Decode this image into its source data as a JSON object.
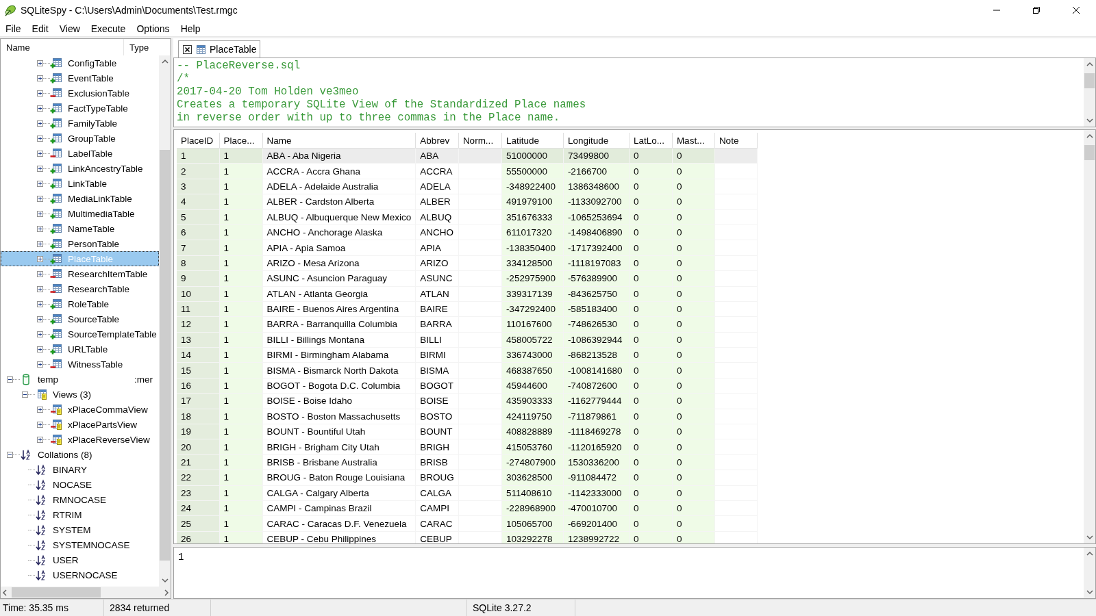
{
  "window": {
    "title": "SQLiteSpy - C:\\Users\\Admin\\Documents\\Test.rmgc"
  },
  "menu": [
    "File",
    "Edit",
    "View",
    "Execute",
    "Options",
    "Help"
  ],
  "tree": {
    "columns": [
      "Name",
      "Type"
    ],
    "items": [
      {
        "children": [
          {
            "children": [
              {
                "label": "ConfigTable",
                "kind": "table_plus",
                "expanded": false,
                "selected": false
              },
              {
                "label": "EventTable",
                "kind": "table_plus",
                "expanded": false,
                "selected": false
              },
              {
                "label": "ExclusionTable",
                "kind": "table_minus",
                "expanded": false,
                "selected": false
              },
              {
                "label": "FactTypeTable",
                "kind": "table_plus",
                "expanded": false,
                "selected": false
              },
              {
                "label": "FamilyTable",
                "kind": "table_plus",
                "expanded": false,
                "selected": false
              },
              {
                "label": "GroupTable",
                "kind": "table_plus",
                "expanded": false,
                "selected": false
              },
              {
                "label": "LabelTable",
                "kind": "table_minus",
                "expanded": false,
                "selected": false
              },
              {
                "label": "LinkAncestryTable",
                "kind": "table_plus",
                "expanded": false,
                "selected": false
              },
              {
                "label": "LinkTable",
                "kind": "table_plus",
                "expanded": false,
                "selected": false
              },
              {
                "label": "MediaLinkTable",
                "kind": "table_plus",
                "expanded": false,
                "selected": false
              },
              {
                "label": "MultimediaTable",
                "kind": "table_plus",
                "expanded": false,
                "selected": false
              },
              {
                "label": "NameTable",
                "kind": "table_plus",
                "expanded": false,
                "selected": false
              },
              {
                "label": "PersonTable",
                "kind": "table_plus",
                "expanded": false,
                "selected": false
              },
              {
                "label": "PlaceTable",
                "kind": "table_plus",
                "expanded": false,
                "selected": true
              },
              {
                "label": "ResearchItemTable",
                "kind": "table_minus",
                "expanded": false,
                "selected": false
              },
              {
                "label": "ResearchTable",
                "kind": "table_minus",
                "expanded": false,
                "selected": false
              },
              {
                "label": "RoleTable",
                "kind": "table_plus",
                "expanded": false,
                "selected": false
              },
              {
                "label": "SourceTable",
                "kind": "table_plus",
                "expanded": false,
                "selected": false
              },
              {
                "label": "SourceTemplateTable",
                "kind": "table_plus",
                "expanded": false,
                "selected": false
              },
              {
                "label": "URLTable",
                "kind": "table_plus",
                "expanded": false,
                "selected": false
              },
              {
                "label": "WitnessTable",
                "kind": "table_minus",
                "expanded": false,
                "selected": false
              }
            ]
          }
        ]
      },
      {
        "label": "temp",
        "type": ":mer",
        "kind": "database",
        "expanded": true,
        "selected": false,
        "children": [
          {
            "label": "Views (3)",
            "kind": "views",
            "expanded": true,
            "selected": false,
            "children": [
              {
                "label": "xPlaceCommaView",
                "kind": "view",
                "expanded": false,
                "selected": false
              },
              {
                "label": "xPlacePartsView",
                "kind": "view",
                "expanded": false,
                "selected": false
              },
              {
                "label": "xPlaceReverseView",
                "kind": "view",
                "expanded": false,
                "selected": false
              }
            ]
          }
        ]
      },
      {
        "label": "Collations (8)",
        "kind": "collations",
        "expanded": true,
        "selected": false,
        "children": [
          {
            "label": "BINARY",
            "kind": "collation",
            "selected": false
          },
          {
            "label": "NOCASE",
            "kind": "collation",
            "selected": false
          },
          {
            "label": "RMNOCASE",
            "kind": "collation",
            "selected": false
          },
          {
            "label": "RTRIM",
            "kind": "collation",
            "selected": false
          },
          {
            "label": "SYSTEM",
            "kind": "collation",
            "selected": false
          },
          {
            "label": "SYSTEMNOCASE",
            "kind": "collation",
            "selected": false
          },
          {
            "label": "USER",
            "kind": "collation",
            "selected": false
          },
          {
            "label": "USERNOCASE",
            "kind": "collation",
            "selected": false
          }
        ]
      }
    ]
  },
  "tabs": [
    {
      "label": "PlaceTable",
      "selected": true
    }
  ],
  "sql_editor": {
    "lines": [
      "-- PlaceReverse.sql",
      "/*",
      "2017-04-20 Tom Holden ve3meo",
      "Creates a temporary SQLite View of the Standardized Place names",
      "in reverse order with up to three commas in the Place name."
    ]
  },
  "grid": {
    "columns": [
      {
        "label": "PlaceID",
        "kind": "integer"
      },
      {
        "label": "Place...",
        "kind": "integer"
      },
      {
        "label": "Name",
        "kind": "text"
      },
      {
        "label": "Abbrev",
        "kind": "text"
      },
      {
        "label": "Norm...",
        "kind": "text"
      },
      {
        "label": "Latitude",
        "kind": "integer"
      },
      {
        "label": "Longitude",
        "kind": "integer"
      },
      {
        "label": "LatLo...",
        "kind": "integer"
      },
      {
        "label": "Mast...",
        "kind": "integer"
      },
      {
        "label": "Note",
        "kind": "text"
      }
    ],
    "rows": [
      {
        "selected": true,
        "cells": [
          "1",
          "1",
          "ABA - Aba Nigeria",
          "ABA",
          null,
          "51000000",
          "73499800",
          "0",
          "0",
          null
        ]
      },
      {
        "selected": false,
        "cells": [
          "2",
          "1",
          "ACCRA - Accra Ghana",
          "ACCRA",
          null,
          "55500000",
          "-2166700",
          "0",
          "0",
          null
        ]
      },
      {
        "selected": false,
        "cells": [
          "3",
          "1",
          "ADELA - Adelaide Australia",
          "ADELA",
          null,
          "-348922400",
          "1386348600",
          "0",
          "0",
          null
        ]
      },
      {
        "selected": false,
        "cells": [
          "4",
          "1",
          "ALBER - Cardston Alberta",
          "ALBER",
          null,
          "491979100",
          "-1133092700",
          "0",
          "0",
          null
        ]
      },
      {
        "selected": false,
        "cells": [
          "5",
          "1",
          "ALBUQ - Albuquerque New Mexico",
          "ALBUQ",
          null,
          "351676333",
          "-1065253694",
          "0",
          "0",
          null
        ]
      },
      {
        "selected": false,
        "cells": [
          "6",
          "1",
          "ANCHO - Anchorage Alaska",
          "ANCHO",
          null,
          "611017320",
          "-1498406890",
          "0",
          "0",
          null
        ]
      },
      {
        "selected": false,
        "cells": [
          "7",
          "1",
          "APIA - Apia Samoa",
          "APIA",
          null,
          "-138350400",
          "-1717392400",
          "0",
          "0",
          null
        ]
      },
      {
        "selected": false,
        "cells": [
          "8",
          "1",
          "ARIZO - Mesa Arizona",
          "ARIZO",
          null,
          "334128500",
          "-1118197083",
          "0",
          "0",
          null
        ]
      },
      {
        "selected": false,
        "cells": [
          "9",
          "1",
          "ASUNC - Asuncion Paraguay",
          "ASUNC",
          null,
          "-252975900",
          "-576389900",
          "0",
          "0",
          null
        ]
      },
      {
        "selected": false,
        "cells": [
          "10",
          "1",
          "ATLAN - Atlanta Georgia",
          "ATLAN",
          null,
          "339317139",
          "-843625750",
          "0",
          "0",
          null
        ]
      },
      {
        "selected": false,
        "cells": [
          "11",
          "1",
          "BAIRE - Buenos Aires Argentina",
          "BAIRE",
          null,
          "-347292400",
          "-585183400",
          "0",
          "0",
          null
        ]
      },
      {
        "selected": false,
        "cells": [
          "12",
          "1",
          "BARRA - Barranquilla Columbia",
          "BARRA",
          null,
          "110167600",
          "-748626530",
          "0",
          "0",
          null
        ]
      },
      {
        "selected": false,
        "cells": [
          "13",
          "1",
          "BILLI - Billings Montana",
          "BILLI",
          null,
          "458005722",
          "-1086392944",
          "0",
          "0",
          null
        ]
      },
      {
        "selected": false,
        "cells": [
          "14",
          "1",
          "BIRMI - Birmingham Alabama",
          "BIRMI",
          null,
          "336743000",
          "-868213528",
          "0",
          "0",
          null
        ]
      },
      {
        "selected": false,
        "cells": [
          "15",
          "1",
          "BISMA - Bismarck North Dakota",
          "BISMA",
          null,
          "468387650",
          "-1008141680",
          "0",
          "0",
          null
        ]
      },
      {
        "selected": false,
        "cells": [
          "16",
          "1",
          "BOGOT - Bogota D.C. Columbia",
          "BOGOT",
          null,
          "45944600",
          "-740872600",
          "0",
          "0",
          null
        ]
      },
      {
        "selected": false,
        "cells": [
          "17",
          "1",
          "BOISE - Boise Idaho",
          "BOISE",
          null,
          "435903333",
          "-1162779444",
          "0",
          "0",
          null
        ]
      },
      {
        "selected": false,
        "cells": [
          "18",
          "1",
          "BOSTO - Boston Massachusetts",
          "BOSTO",
          null,
          "424119750",
          "-711879861",
          "0",
          "0",
          null
        ]
      },
      {
        "selected": false,
        "cells": [
          "19",
          "1",
          "BOUNT - Bountiful Utah",
          "BOUNT",
          null,
          "408828889",
          "-1118469278",
          "0",
          "0",
          null
        ]
      },
      {
        "selected": false,
        "cells": [
          "20",
          "1",
          "BRIGH - Brigham City Utah",
          "BRIGH",
          null,
          "415053760",
          "-1120165920",
          "0",
          "0",
          null
        ]
      },
      {
        "selected": false,
        "cells": [
          "21",
          "1",
          "BRISB - Brisbane Australia",
          "BRISB",
          null,
          "-274807900",
          "1530336200",
          "0",
          "0",
          null
        ]
      },
      {
        "selected": false,
        "cells": [
          "22",
          "1",
          "BROUG - Baton Rouge Louisiana",
          "BROUG",
          null,
          "303628500",
          "-911084472",
          "0",
          "0",
          null
        ]
      },
      {
        "selected": false,
        "cells": [
          "23",
          "1",
          "CALGA - Calgary Alberta",
          "CALGA",
          null,
          "511408610",
          "-1142333000",
          "0",
          "0",
          null
        ]
      },
      {
        "selected": false,
        "cells": [
          "24",
          "1",
          "CAMPI - Campinas Brazil",
          "CAMPI",
          null,
          "-228968900",
          "-470010700",
          "0",
          "0",
          null
        ]
      },
      {
        "selected": false,
        "cells": [
          "25",
          "1",
          "CARAC - Caracas D.F. Venezuela",
          "CARAC",
          null,
          "105065700",
          "-669201400",
          "0",
          "0",
          null
        ]
      },
      {
        "selected": false,
        "cells": [
          "26",
          "1",
          "CEBUP - Cebu Philippines",
          "CEBUP",
          null,
          "103292278",
          "1238992722",
          "0",
          "0",
          null
        ]
      }
    ]
  },
  "output": {
    "text": "1"
  },
  "status_bar": {
    "time": "Time: 35.35 ms",
    "rows": "2834 returned",
    "version": "SQLite 3.27.2"
  }
}
